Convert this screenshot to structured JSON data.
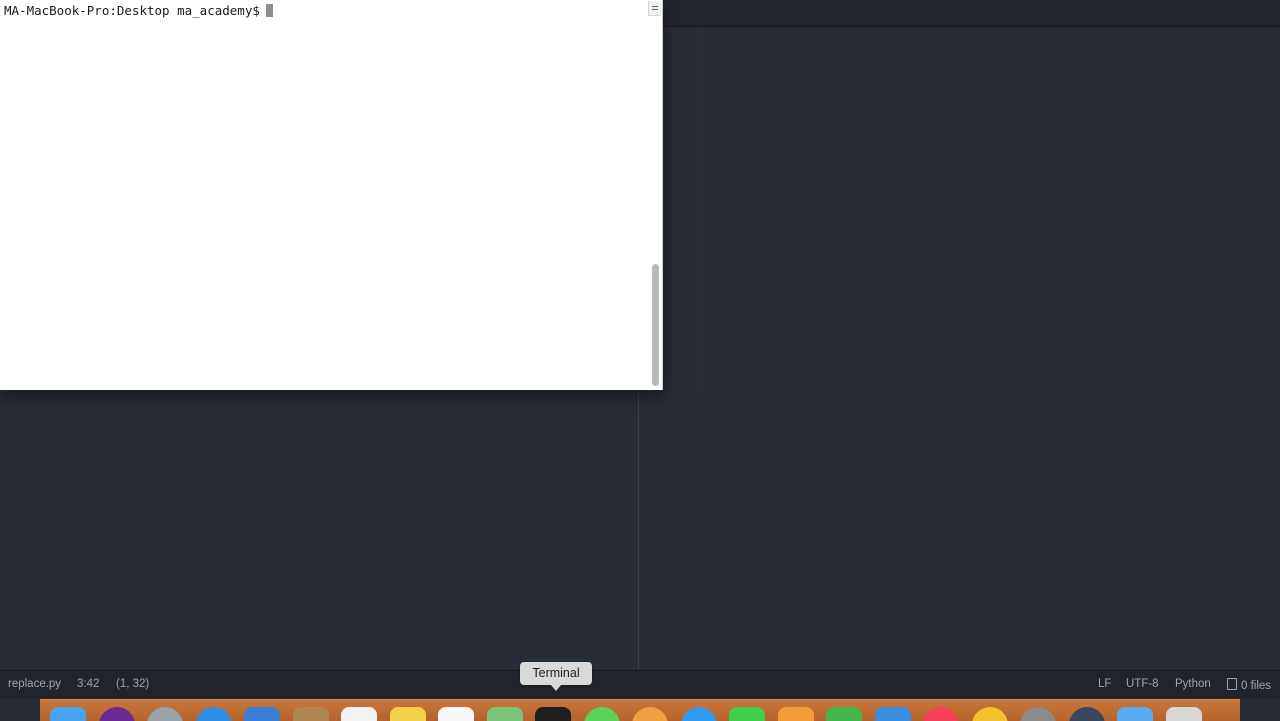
{
  "terminal": {
    "prompt": "MA-MacBook-Pro:Desktop ma_academy$"
  },
  "statusbar": {
    "filename": "replace.py",
    "time": "3:42",
    "cursor_position": "(1, 32)",
    "line_ending": "LF",
    "encoding": "UTF-8",
    "grammar": "Python",
    "files": "0 files"
  },
  "tooltip": {
    "label": "Terminal"
  },
  "dock": {
    "apps": [
      {
        "name": "finder-icon",
        "color": "#4aa3f0"
      },
      {
        "name": "siri-icon",
        "color": "#6b2a8f"
      },
      {
        "name": "launchpad-icon",
        "color": "#9aa2ab"
      },
      {
        "name": "safari-icon",
        "color": "#2e8fe8"
      },
      {
        "name": "mail-icon",
        "color": "#3d7ed8"
      },
      {
        "name": "contacts-icon",
        "color": "#b08450"
      },
      {
        "name": "calendar-icon",
        "color": "#f2f2f2"
      },
      {
        "name": "notes-icon",
        "color": "#f4d24a"
      },
      {
        "name": "reminders-icon",
        "color": "#f7f7f7"
      },
      {
        "name": "maps-icon",
        "color": "#7cc47a"
      },
      {
        "name": "terminal-icon",
        "color": "#1e1e1e"
      },
      {
        "name": "messages-icon",
        "color": "#5cd25a"
      },
      {
        "name": "photos-icon",
        "color": "#f0a040"
      },
      {
        "name": "appstore-icon",
        "color": "#2f9bf0"
      },
      {
        "name": "facetime-icon",
        "color": "#3fcf4a"
      },
      {
        "name": "books-icon",
        "color": "#f29c38"
      },
      {
        "name": "numbers-icon",
        "color": "#43b649"
      },
      {
        "name": "keynote-icon",
        "color": "#3b8de0"
      },
      {
        "name": "music-icon",
        "color": "#f5425a"
      },
      {
        "name": "emoji-icon",
        "color": "#f6c12e"
      },
      {
        "name": "system-preferences-icon",
        "color": "#8a8a8a"
      },
      {
        "name": "atom-icon",
        "color": "#3a4560"
      },
      {
        "name": "downloads-folder-icon",
        "color": "#5aaaf0"
      },
      {
        "name": "trash-icon",
        "color": "#d8d8d8"
      }
    ]
  }
}
